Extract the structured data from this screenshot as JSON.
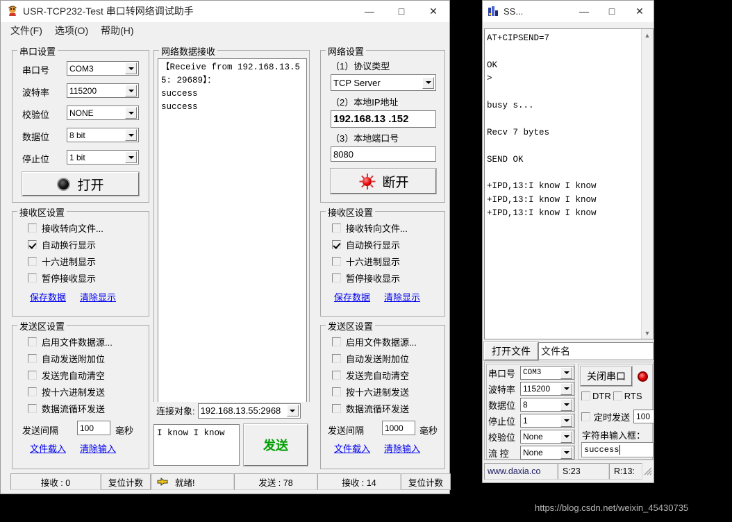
{
  "watermark": "https://blog.csdn.net/weixin_45430735",
  "left_window": {
    "title": "USR-TCP232-Test 串口转网络调试助手",
    "icon": "app-icon",
    "window_buttons": {
      "minimize": "—",
      "maximize": "□",
      "close": "✕"
    },
    "menu": [
      "文件(F)",
      "选项(O)",
      "帮助(H)"
    ],
    "serial_settings": {
      "legend": "串口设置",
      "rows": [
        {
          "label": "串口号",
          "value": "COM3"
        },
        {
          "label": "波特率",
          "value": "115200"
        },
        {
          "label": "校验位",
          "value": "NONE"
        },
        {
          "label": "数据位",
          "value": "8 bit"
        },
        {
          "label": "停止位",
          "value": "1 bit"
        }
      ],
      "open_button": "打开"
    },
    "recv_settings_left": {
      "legend": "接收区设置",
      "checkboxes": [
        {
          "label": "接收转向文件...",
          "checked": false
        },
        {
          "label": "自动换行显示",
          "checked": true
        },
        {
          "label": "十六进制显示",
          "checked": false
        },
        {
          "label": "暂停接收显示",
          "checked": false
        }
      ],
      "links": [
        "保存数据",
        "清除显示"
      ]
    },
    "send_settings_left": {
      "legend": "发送区设置",
      "checkboxes": [
        {
          "label": "启用文件数据源...",
          "checked": false
        },
        {
          "label": "自动发送附加位",
          "checked": false
        },
        {
          "label": "发送完自动清空",
          "checked": false
        },
        {
          "label": "按十六进制发送",
          "checked": false
        },
        {
          "label": "数据流循环发送",
          "checked": false
        }
      ],
      "interval_label": "发送间隔",
      "interval_value": "100",
      "interval_unit": "毫秒",
      "links": [
        "文件载入",
        "清除输入"
      ]
    },
    "net_recv": {
      "legend": "网络数据接收",
      "content": "【Receive from 192.168.13.55: 29689】：\nsuccess\nsuccess"
    },
    "connect_target": {
      "label": "连接对象:",
      "value": "192.168.13.55:2968"
    },
    "send_box": {
      "value": "I know I know",
      "send_button": "发送"
    },
    "net_settings": {
      "legend": "网络设置",
      "protocol_label": "（1）协议类型",
      "protocol_value": "TCP Server",
      "ip_label": "（2）本地IP地址",
      "ip_value": "192.168.13 .152",
      "port_label": "（3）本地端口号",
      "port_value": "8080",
      "disconnect_button": "断开"
    },
    "recv_settings_right": {
      "legend": "接收区设置",
      "checkboxes": [
        {
          "label": "接收转向文件...",
          "checked": false
        },
        {
          "label": "自动换行显示",
          "checked": true
        },
        {
          "label": "十六进制显示",
          "checked": false
        },
        {
          "label": "暂停接收显示",
          "checked": false
        }
      ],
      "links": [
        "保存数据",
        "清除显示"
      ]
    },
    "send_settings_right": {
      "legend": "发送区设置",
      "checkboxes": [
        {
          "label": "启用文件数据源...",
          "checked": false
        },
        {
          "label": "自动发送附加位",
          "checked": false
        },
        {
          "label": "发送完自动清空",
          "checked": false
        },
        {
          "label": "按十六进制发送",
          "checked": false
        },
        {
          "label": "数据流循环发送",
          "checked": false
        }
      ],
      "interval_label": "发送间隔",
      "interval_value": "1000",
      "interval_unit": "毫秒",
      "links": [
        "文件载入",
        "清除输入"
      ]
    },
    "statusbar": {
      "recv_count": "接收 : 0",
      "reset_left": "复位计数",
      "ready": "就绪!",
      "send_count": "发送 : 78",
      "recv_count2": "接收 : 14",
      "reset_right": "复位计数"
    }
  },
  "right_window": {
    "title": "SS...",
    "icon": "serial-app-icon",
    "window_buttons": {
      "minimize": "—",
      "maximize": "□",
      "close": "✕"
    },
    "terminal": "AT+CIPSEND=7\n\nOK\n>\n\nbusy s...\n\nRecv 7 bytes\n\nSEND OK\n\n+IPD,13:I know I know\n+IPD,13:I know I know\n+IPD,13:I know I know",
    "file_row": {
      "open_button": "打开文件",
      "filename_placeholder": "文件名"
    },
    "serial": {
      "rows": [
        {
          "label": "串口号",
          "value": "COM3"
        },
        {
          "label": "波特率",
          "value": "115200"
        },
        {
          "label": "数据位",
          "value": "8"
        },
        {
          "label": "停止位",
          "value": "1"
        },
        {
          "label": "校验位",
          "value": "None"
        },
        {
          "label": "流 控",
          "value": "None"
        }
      ],
      "close_button": "关闭串口",
      "dtr_label": "DTR",
      "dtr_checked": false,
      "rts_label": "RTS",
      "rts_checked": false,
      "timed_send_label": "定时发送",
      "timed_send_checked": false,
      "timed_send_value": "100",
      "string_input_label": "字符串输入框：",
      "string_input_value": "success"
    },
    "statusbar": {
      "site": "www.daxia.co",
      "sent": "S:23",
      "recv": "R:13:"
    }
  }
}
